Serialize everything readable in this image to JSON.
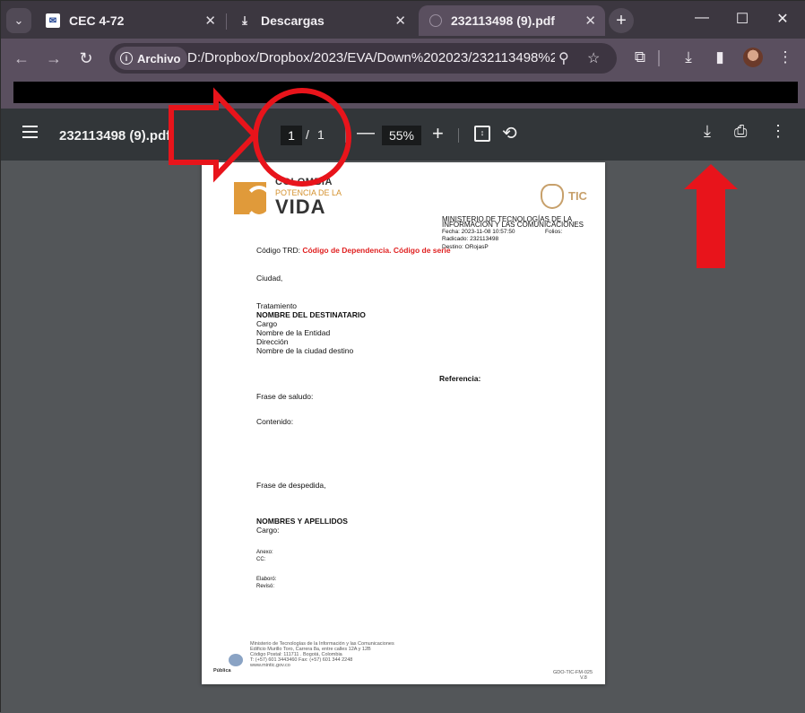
{
  "tabs": [
    {
      "title": "CEC 4-72",
      "close": "✕"
    },
    {
      "title": "Descargas",
      "close": "✕"
    },
    {
      "title": "232113498 (9).pdf",
      "close": "✕",
      "active": true
    }
  ],
  "toolbar": {
    "chip_label": "Archivo",
    "url": "D:/Dropbox/Dropbox/2023/EVA/Down%202023/232113498%20..."
  },
  "pdf": {
    "title": "232113498 (9).pdf",
    "page_current": "1",
    "page_sep": "/",
    "page_total": "1",
    "zoom": "55%"
  },
  "document": {
    "logo_line1": "COLOMBIA",
    "logo_line2": "POTENCIA DE LA",
    "logo_line3": "VIDA",
    "tic": "TIC",
    "ministry_l1": "MINISTERIO DE TECNOLOGÍAS DE LA",
    "ministry_l2": "INFORMACIÓN Y LAS COMUNICACIONES",
    "fecha": "Fecha: 2023-11-08 10:57:50",
    "folios": "Folios:",
    "radicado": "Radicado: 232113498",
    "destino": "Destino: ORojasP",
    "trd_label": "Código TRD: ",
    "trd_value": "Código de Dependencia. Código de serie",
    "ciudad": "Ciudad,",
    "tratamiento": "Tratamiento",
    "destinatario": "NOMBRE DEL DESTINATARIO",
    "cargo": "Cargo",
    "entidad": "Nombre de la Entidad",
    "direccion": "Dirección",
    "ciudad_destino": "Nombre de la ciudad destino",
    "referencia": "Referencia:",
    "saludo": "Frase de saludo:",
    "contenido": "Contenido:",
    "despedida": "Frase de despedida,",
    "nombres": "NOMBRES Y APELLIDOS",
    "cargo2": "Cargo:",
    "anexo": "Anexo:",
    "cc": "CC:",
    "elaboro": "Elaboró:",
    "reviso": "Revisó:",
    "footer_l1": "Ministerio de Tecnologías de la Información y las Comunicaciones",
    "footer_l2": "Edificio Murillo Toro, Carrera 8a, entre calles 12A y 12B",
    "footer_l3": "Código Postal: 111711 . Bogotá, Colombia",
    "footer_l4": "T: (+57) 601 3443460 Fax: (+57) 601 344 2248",
    "footer_l5": "www.mintic.gov.co",
    "publica": "Pública",
    "code_l1": "GDO-TIC-FM-025",
    "code_l2": "V.8"
  },
  "colors": {
    "annotation": "#e8141b",
    "tab_bg": "#3c3740",
    "toolbar_bg": "#5a4f5f",
    "pdfbar_bg": "#323639"
  }
}
